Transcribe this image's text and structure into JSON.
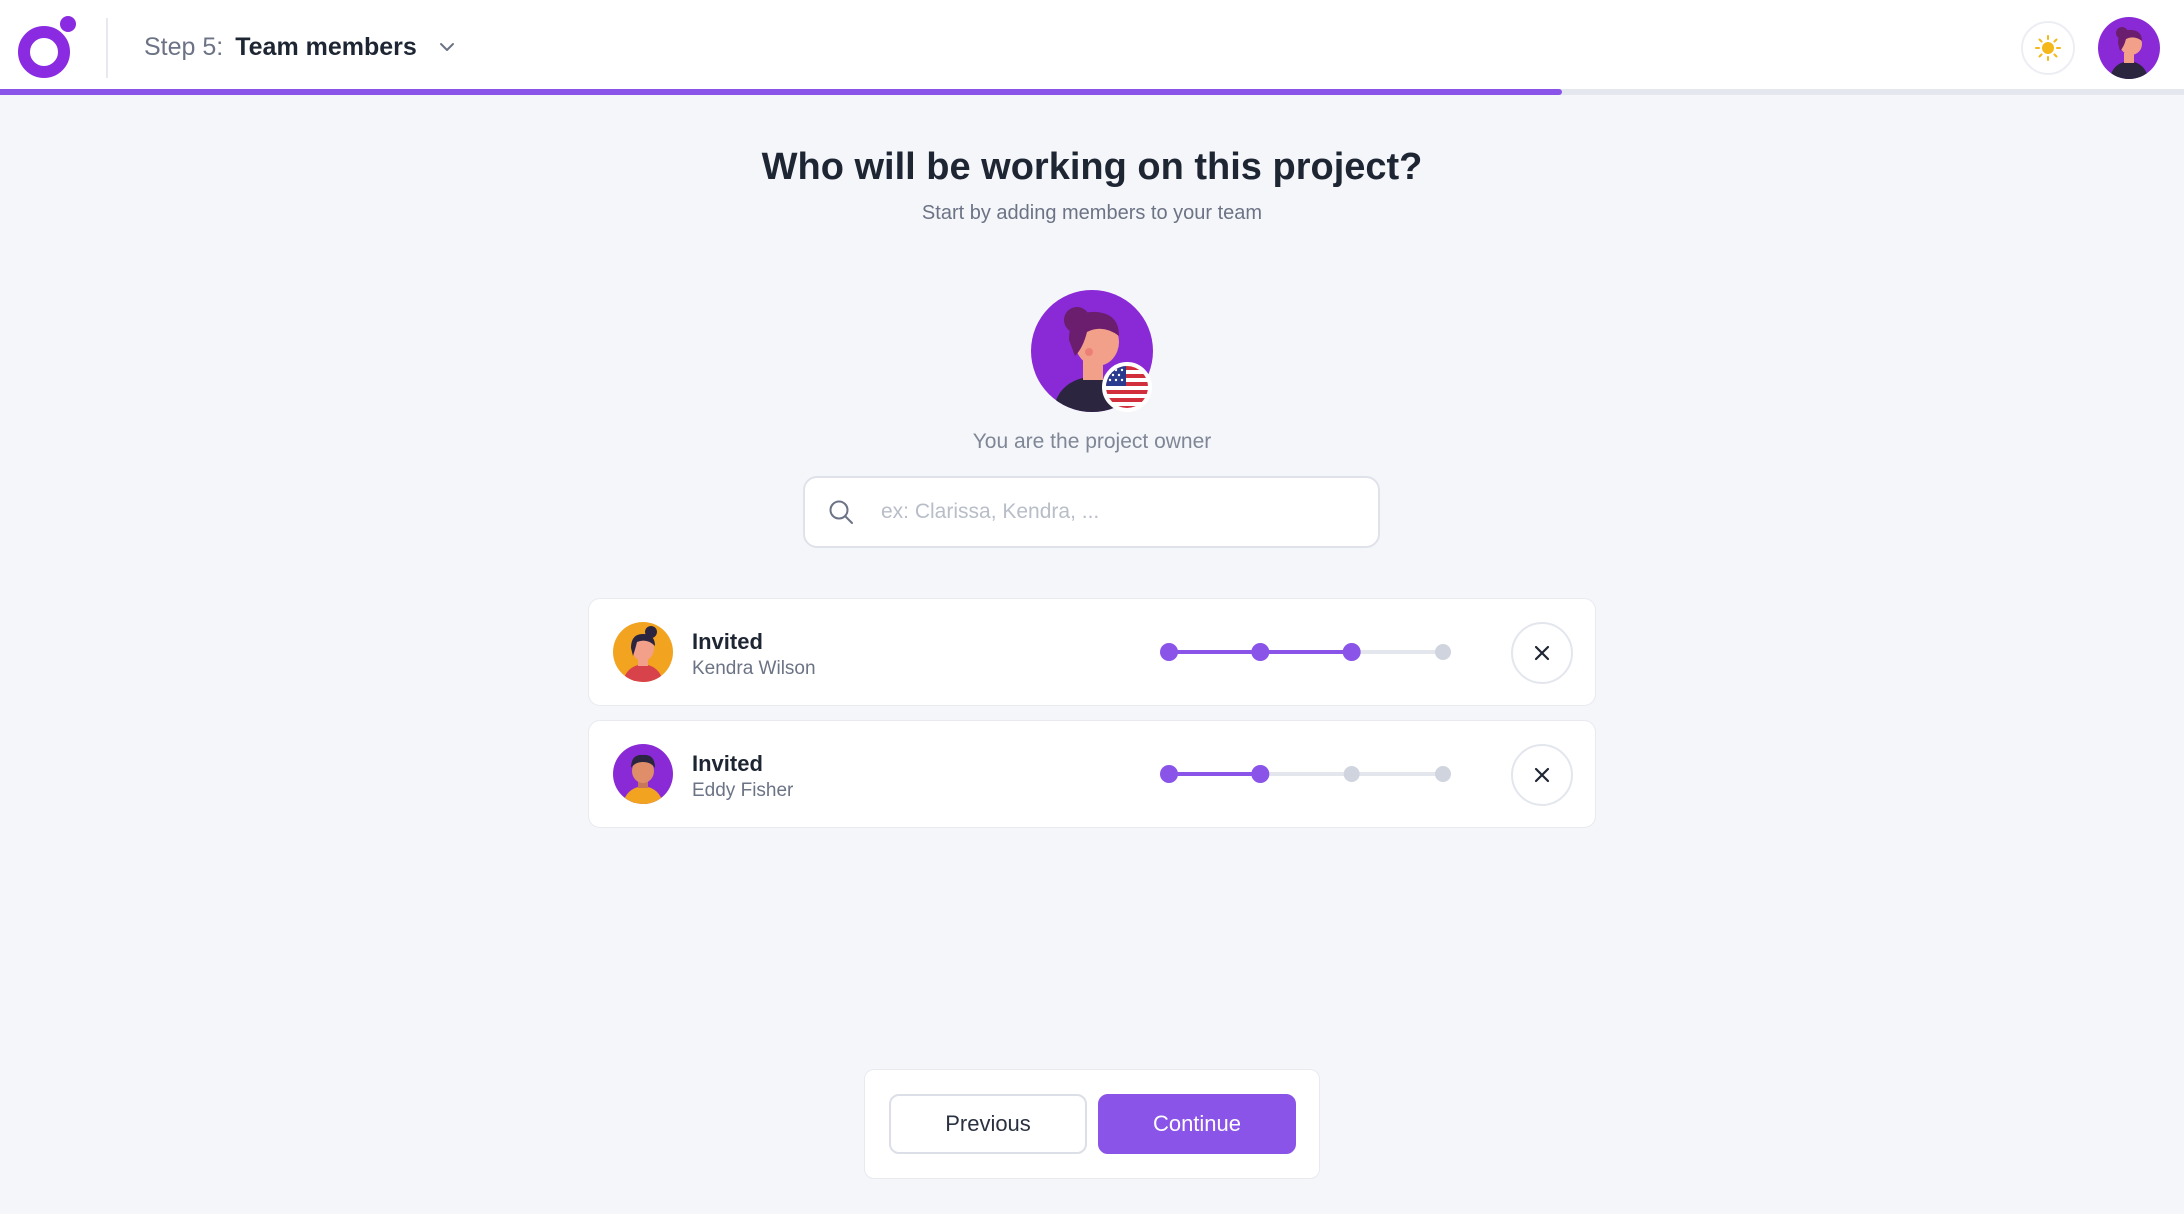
{
  "header": {
    "step_prefix": "Step 5:",
    "step_title": "Team members",
    "progress": 0.715,
    "icons": {
      "logo": "app-logo",
      "chevron": "chevron-down-icon",
      "theme": "sun-icon"
    }
  },
  "main": {
    "title": "Who will be working on this project?",
    "subtitle": "Start by adding members to your team",
    "owner_caption": "You are the project owner",
    "owner_flag": "us-flag-icon"
  },
  "search": {
    "placeholder": "ex: Clarissa, Kendra, ..."
  },
  "members": [
    {
      "status": "Invited",
      "name": "Kendra Wilson",
      "steps_total": 4,
      "steps_completed": 3,
      "avatar_bg": "#f2a31f"
    },
    {
      "status": "Invited",
      "name": "Eddy Fisher",
      "steps_total": 4,
      "steps_completed": 2,
      "avatar_bg": "#8a2ad6"
    }
  ],
  "footer": {
    "previous_label": "Previous",
    "continue_label": "Continue"
  },
  "colors": {
    "accent": "#8a54e8",
    "step_inactive": "#cfd4de",
    "background": "#f5f6fa"
  }
}
